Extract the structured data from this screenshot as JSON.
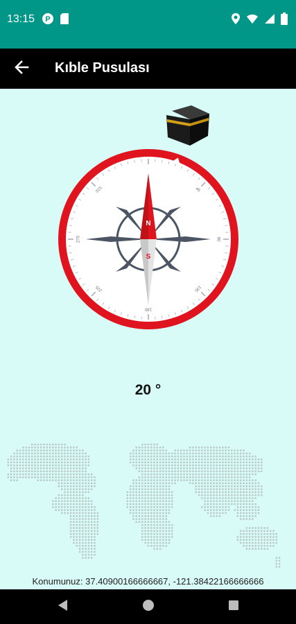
{
  "status_bar": {
    "time": "13:15",
    "left_icons": [
      "app-notification-icon",
      "sd-card-icon"
    ],
    "right_icons": [
      "location-icon",
      "wifi-icon",
      "signal-icon",
      "battery-icon"
    ]
  },
  "app_bar": {
    "title": "Kıble Pusulası",
    "back_icon": "arrow-back-icon"
  },
  "compass": {
    "heading_degrees": 0,
    "qibla_marker_degrees": 20,
    "needle_north_label": "N",
    "needle_south_label": "S",
    "dial_labels": [
      "0",
      "45",
      "90",
      "135",
      "180",
      "225",
      "270",
      "315"
    ],
    "colors": {
      "ring": "#e0141e",
      "needle_north": "#e0141e",
      "needle_south": "#d4d4d4",
      "star": "#4b5563"
    }
  },
  "qibla": {
    "degree_text": "20 °",
    "kaaba_icon": "kaaba-icon"
  },
  "location": {
    "text": "Konumunuz: 37.40900166666667, -121.38422166666666"
  },
  "nav_bar": {
    "icons": [
      "back-triangle-icon",
      "home-circle-icon",
      "recents-square-icon"
    ]
  },
  "theme": {
    "status_bar": "#009688",
    "app_bar": "#000000",
    "background": "#d8fbf7"
  }
}
